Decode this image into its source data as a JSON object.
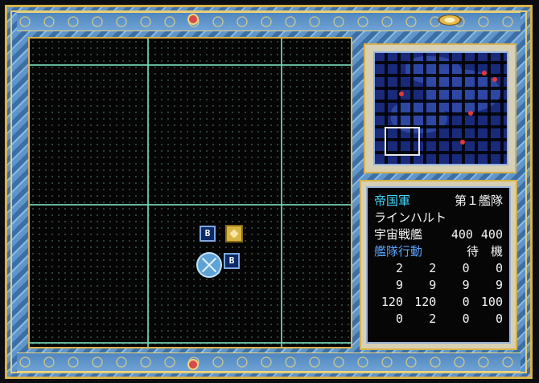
{
  "unit_panel": {
    "faction": "帝国軍",
    "fleet": "第１艦隊",
    "commander": "ラインハルト",
    "ship_label": "宇宙戦艦",
    "ship_values": [
      "400",
      "400"
    ],
    "action_label": "艦隊行動",
    "action_value": "待　機",
    "stats": [
      [
        "2",
        "2",
        "0",
        "0"
      ],
      [
        "9",
        "9",
        "9",
        "9"
      ],
      [
        "120",
        "120",
        "0",
        "100"
      ],
      [
        "0",
        "2",
        "0",
        "0"
      ]
    ]
  },
  "map_units": {
    "unit_b_1": "B",
    "unit_b_2": "B"
  },
  "colors": {
    "frame_blue": "#5f95c9",
    "frame_gold": "#d9b24a",
    "grid_line": "#78d6b4",
    "text_cyan": "#42d8ff",
    "text_white": "#f4f4f4",
    "enemy_red": "#e23a3a"
  },
  "icons": {
    "unit_gold": "gold-diamond-unit-icon",
    "unit_flagship": "flagship-crest-icon",
    "emblem": "winged-emblem-icon"
  }
}
